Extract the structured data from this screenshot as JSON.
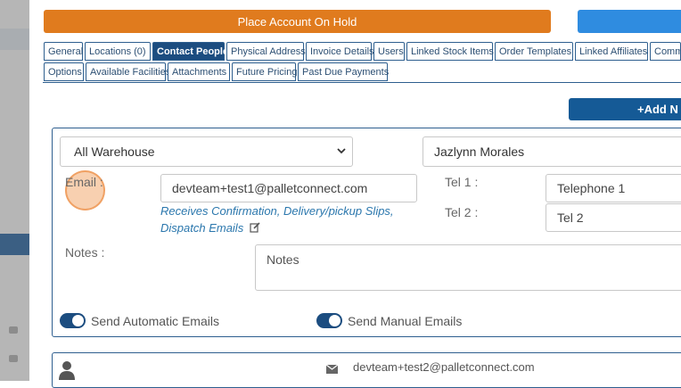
{
  "actions": {
    "hold_label": "Place Account On Hold",
    "add_label": "+Add N"
  },
  "tabs_row1": [
    {
      "label": "General"
    },
    {
      "label": "Locations (0)"
    },
    {
      "label": "Contact People",
      "active": true
    },
    {
      "label": "Physical Address"
    },
    {
      "label": "Invoice Details"
    },
    {
      "label": "Users"
    },
    {
      "label": "Linked Stock Items"
    },
    {
      "label": "Order Templates"
    },
    {
      "label": "Linked Affiliates"
    },
    {
      "label": "Comm"
    }
  ],
  "tabs_row2": [
    {
      "label": "Options"
    },
    {
      "label": "Available Facilities"
    },
    {
      "label": "Attachments"
    },
    {
      "label": "Future Pricing"
    },
    {
      "label": "Past Due Payments"
    }
  ],
  "contact": {
    "warehouse_value": "All Warehouse",
    "name_value": "Jazlynn Morales",
    "email_label": "Email :",
    "email_value": "devteam+test1@palletconnect.com",
    "email_link_line1": "Receives Confirmation, Delivery/pickup Slips,",
    "email_link_line2": "Dispatch Emails",
    "tel1_label": "Tel 1 :",
    "tel1_placeholder": "Telephone 1",
    "tel2_label": "Tel 2 :",
    "tel2_placeholder": "Tel 2",
    "notes_label": "Notes :",
    "notes_placeholder": "Notes",
    "auto_emails_label": "Send Automatic Emails",
    "manual_emails_label": "Send Manual Emails"
  },
  "second_contact": {
    "email": "devteam+test2@palletconnect.com"
  },
  "icons": {
    "edit": "edit-icon",
    "user": "user-icon",
    "envelope": "envelope-icon",
    "chevron": "chevron-down-icon"
  },
  "colors": {
    "hold_button": "#e07b1e",
    "primary": "#1c4d80",
    "link": "#2b77ad"
  }
}
